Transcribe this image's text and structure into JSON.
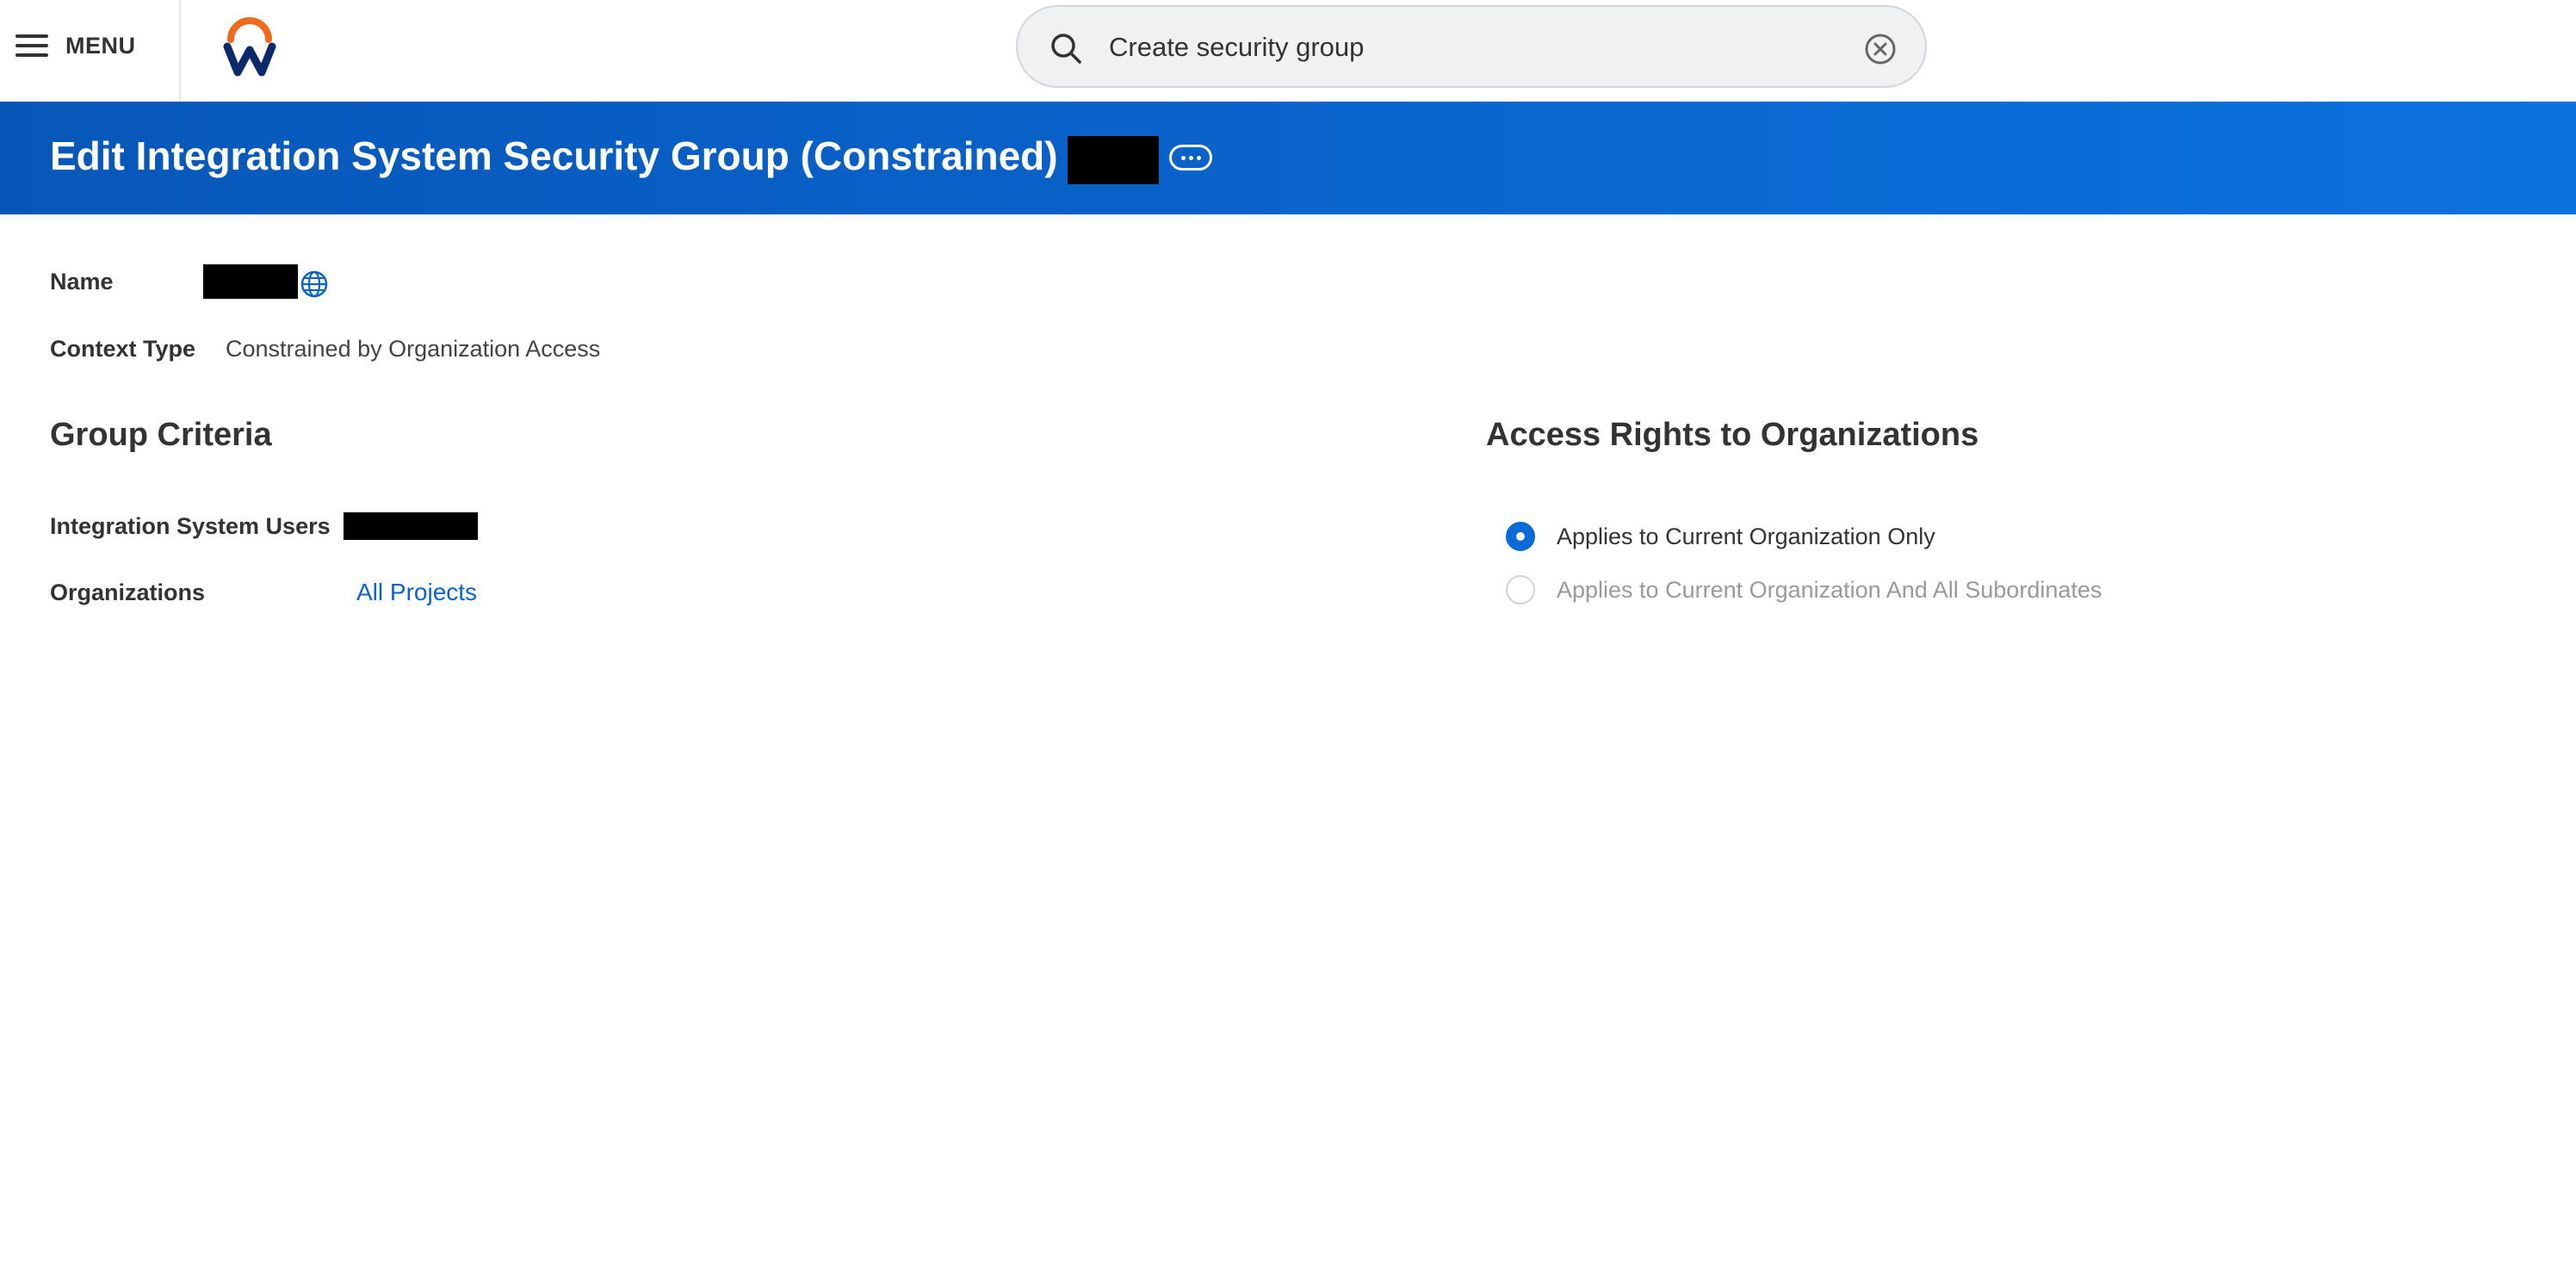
{
  "topbar": {
    "menu_label": "MENU",
    "search_value": "Create security group"
  },
  "header": {
    "title": "Edit Integration System Security Group (Constrained)"
  },
  "details": {
    "name_label": "Name",
    "context_type_label": "Context Type",
    "context_type_value": "Constrained by Organization Access"
  },
  "group_criteria": {
    "title": "Group Criteria",
    "users_label": "Integration System Users",
    "organizations_label": "Organizations",
    "organizations_value": "All Projects"
  },
  "access_rights": {
    "title": "Access Rights to Organizations",
    "options": [
      {
        "label": "Applies to Current Organization Only",
        "selected": true
      },
      {
        "label": "Applies to Current Organization And All Subordinates",
        "selected": false
      }
    ]
  },
  "colors": {
    "banner": "#0a66d0",
    "link": "#0a63c9",
    "logo_orange": "#f06a1e",
    "logo_navy": "#0a2a6b"
  }
}
